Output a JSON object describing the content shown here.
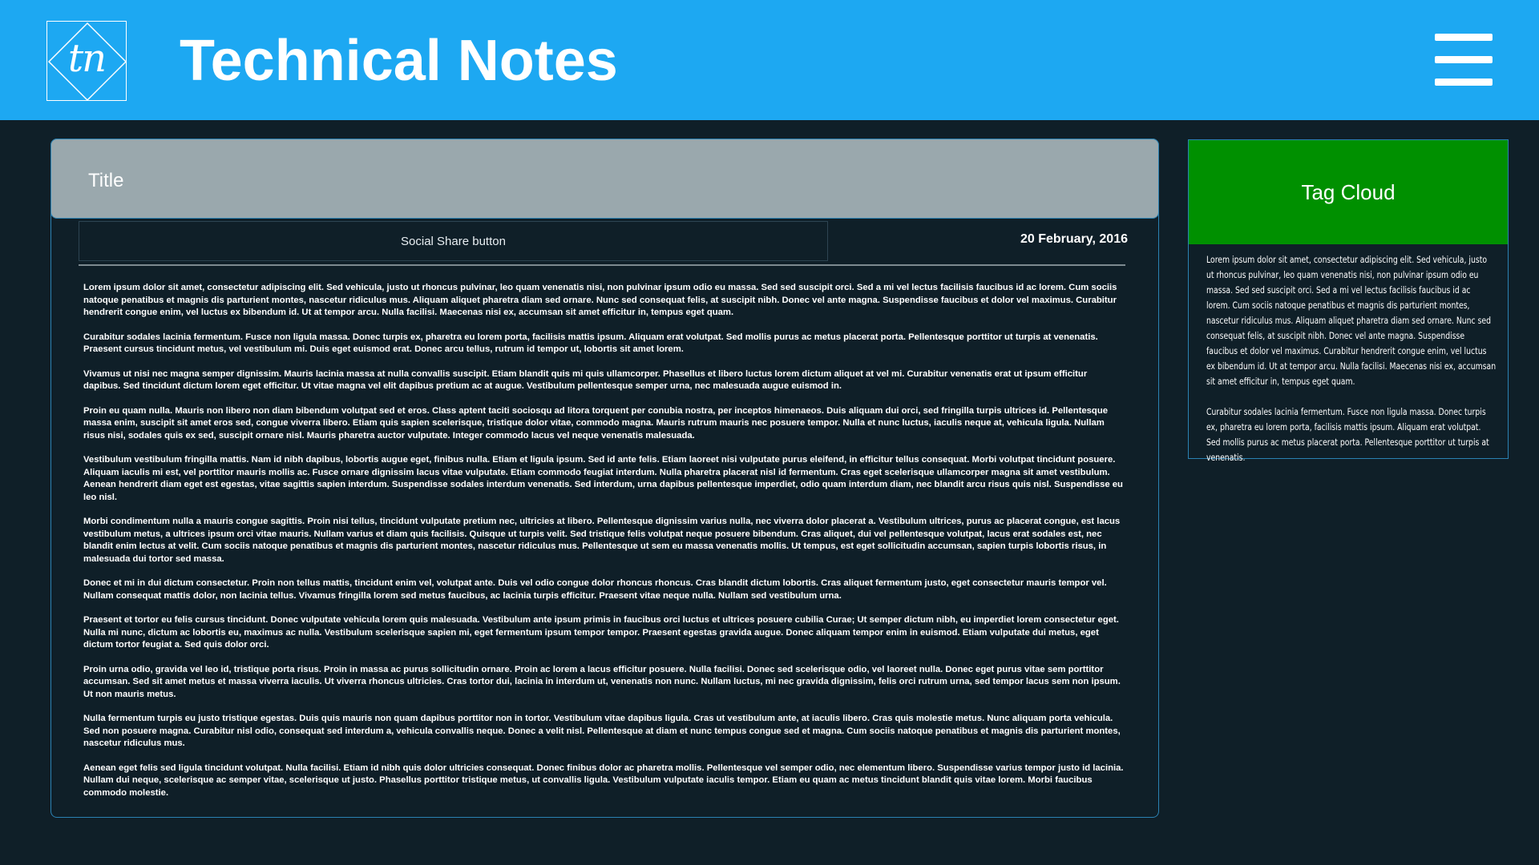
{
  "header": {
    "logo_text": "tn",
    "site_title": "Technical Notes"
  },
  "article": {
    "title": "Title",
    "share_label": "Social Share button",
    "date": "20 February, 2016",
    "paragraphs": [
      "Lorem ipsum dolor sit amet, consectetur adipiscing elit. Sed vehicula, justo ut rhoncus pulvinar, leo quam venenatis nisi, non pulvinar ipsum odio eu massa. Sed sed suscipit orci. Sed a mi vel lectus facilisis faucibus id ac lorem. Cum sociis natoque penatibus et magnis dis parturient montes, nascetur ridiculus mus. Aliquam aliquet pharetra diam sed ornare. Nunc sed consequat felis, at suscipit nibh. Donec vel ante magna. Suspendisse faucibus et dolor vel maximus. Curabitur hendrerit congue enim, vel luctus ex bibendum id. Ut at tempor arcu. Nulla facilisi. Maecenas nisi ex, accumsan sit amet efficitur in, tempus eget quam.",
      "Curabitur sodales lacinia fermentum. Fusce non ligula massa. Donec turpis ex, pharetra eu lorem porta, facilisis mattis ipsum. Aliquam erat volutpat. Sed mollis purus ac metus placerat porta. Pellentesque porttitor ut turpis at venenatis. Praesent cursus tincidunt metus, vel vestibulum mi. Duis eget euismod erat. Donec arcu tellus, rutrum id tempor ut, lobortis sit amet lorem.",
      "Vivamus ut nisi nec magna semper dignissim. Mauris lacinia massa at nulla convallis suscipit. Etiam blandit quis mi quis ullamcorper. Phasellus et libero luctus lorem dictum aliquet at vel mi. Curabitur venenatis erat ut ipsum efficitur dapibus. Sed tincidunt dictum lorem eget efficitur. Ut vitae magna vel elit dapibus pretium ac at augue. Vestibulum pellentesque semper urna, nec malesuada augue euismod in.",
      "Proin eu quam nulla. Mauris non libero non diam bibendum volutpat sed et eros. Class aptent taciti sociosqu ad litora torquent per conubia nostra, per inceptos himenaeos. Duis aliquam dui orci, sed fringilla turpis ultrices id. Pellentesque massa enim, suscipit sit amet eros sed, congue viverra libero. Etiam quis sapien scelerisque, tristique dolor vitae, commodo magna. Mauris rutrum mauris nec posuere tempor. Nulla et nunc luctus, iaculis neque at, vehicula ligula. Nullam risus nisi, sodales quis ex sed, suscipit ornare nisl. Mauris pharetra auctor vulputate. Integer commodo lacus vel neque venenatis malesuada.",
      "Vestibulum vestibulum fringilla mattis. Nam id nibh dapibus, lobortis augue eget, finibus nulla. Etiam et ligula ipsum. Sed id ante felis. Etiam laoreet nisi vulputate purus eleifend, in efficitur tellus consequat. Morbi volutpat tincidunt posuere. Aliquam iaculis mi est, vel porttitor mauris mollis ac. Fusce ornare dignissim lacus vitae vulputate. Etiam commodo feugiat interdum. Nulla pharetra placerat nisl id fermentum. Cras eget scelerisque ullamcorper magna sit amet vestibulum. Aenean hendrerit diam eget est egestas, vitae sagittis sapien interdum. Suspendisse sodales interdum venenatis. Sed interdum, urna dapibus pellentesque imperdiet, odio quam interdum diam, nec blandit arcu risus quis nisl. Suspendisse eu leo nisl.",
      "Morbi condimentum nulla a mauris congue sagittis. Proin nisi tellus, tincidunt vulputate pretium nec, ultricies at libero. Pellentesque dignissim varius nulla, nec viverra dolor placerat a. Vestibulum ultrices, purus ac placerat congue, est lacus vestibulum metus, a ultrices ipsum orci vitae mauris. Nullam varius et diam quis facilisis. Quisque ut turpis velit. Sed tristique felis volutpat neque posuere bibendum. Cras aliquet, dui vel pellentesque volutpat, lacus erat sodales est, nec blandit enim lectus at velit. Cum sociis natoque penatibus et magnis dis parturient montes, nascetur ridiculus mus. Pellentesque ut sem eu massa venenatis mollis. Ut tempus, est eget sollicitudin accumsan, sapien turpis lobortis risus, in malesuada dui tortor sed massa.",
      "Donec et mi in dui dictum consectetur. Proin non tellus mattis, tincidunt enim vel, volutpat ante. Duis vel odio congue dolor rhoncus rhoncus. Cras blandit dictum lobortis. Cras aliquet fermentum justo, eget consectetur mauris tempor vel. Nullam consequat mattis dolor, non lacinia tellus. Vivamus fringilla lorem sed metus faucibus, ac lacinia turpis efficitur. Praesent vitae neque nulla. Nullam sed vestibulum urna.",
      "Praesent et tortor eu felis cursus tincidunt. Donec vulputate vehicula lorem quis malesuada. Vestibulum ante ipsum primis in faucibus orci luctus et ultrices posuere cubilia Curae; Ut semper dictum nibh, eu imperdiet lorem consectetur eget. Nulla mi nunc, dictum ac lobortis eu, maximus ac nulla. Vestibulum scelerisque sapien mi, eget fermentum ipsum tempor tempor. Praesent egestas gravida augue. Donec aliquam tempor enim in euismod. Etiam vulputate dui metus, eget dictum tortor feugiat a. Sed quis dolor orci.",
      "Proin urna odio, gravida vel leo id, tristique porta risus. Proin in massa ac purus sollicitudin ornare. Proin ac lorem a lacus efficitur posuere. Nulla facilisi. Donec sed scelerisque odio, vel laoreet nulla. Donec eget purus vitae sem porttitor accumsan. Sed sit amet metus et massa viverra iaculis. Ut viverra rhoncus ultricies. Cras tortor dui, lacinia in interdum ut, venenatis non nunc. Nullam luctus, mi nec gravida dignissim, felis orci rutrum urna, sed tempor lacus sem non ipsum. Ut non mauris metus.",
      "Nulla fermentum turpis eu justo tristique egestas. Duis quis mauris non quam dapibus porttitor non in tortor. Vestibulum vitae dapibus ligula. Cras ut vestibulum ante, at iaculis libero. Cras quis molestie metus. Nunc aliquam porta vehicula. Sed non posuere magna. Curabitur nisl odio, consequat sed interdum a, vehicula convallis neque. Donec a velit nisl. Pellentesque at diam et nunc tempus congue sed et magna. Cum sociis natoque penatibus et magnis dis parturient montes, nascetur ridiculus mus.",
      "Aenean eget felis sed ligula tincidunt volutpat. Nulla facilisi. Etiam id nibh quis dolor ultricies consequat. Donec finibus dolor ac pharetra mollis. Pellentesque vel semper odio, nec elementum libero. Suspendisse varius tempor justo id lacinia. Nullam dui neque, scelerisque ac semper vitae, scelerisque ut justo. Phasellus porttitor tristique metus, ut convallis ligula. Vestibulum vulputate iaculis tempor. Etiam eu quam ac metus tincidunt blandit quis vitae lorem. Morbi faucibus commodo molestie."
    ]
  },
  "tag_cloud": {
    "title": "Tag Cloud",
    "paragraphs": [
      "Lorem ipsum dolor sit amet, consectetur adipiscing elit. Sed vehicula, justo ut rhoncus pulvinar, leo quam venenatis nisi, non pulvinar ipsum odio eu massa. Sed sed suscipit orci. Sed a mi vel lectus facilisis faucibus id ac lorem. Cum sociis natoque penatibus et magnis dis parturient montes, nascetur ridiculus mus. Aliquam aliquet pharetra diam sed ornare. Nunc sed consequat felis, at suscipit nibh. Donec vel ante magna. Suspendisse faucibus et dolor vel maximus. Curabitur hendrerit congue enim, vel luctus ex bibendum id. Ut at tempor arcu. Nulla facilisi. Maecenas nisi ex, accumsan sit amet efficitur in, tempus eget quam.",
      "Curabitur sodales lacinia fermentum. Fusce non ligula massa. Donec turpis ex, pharetra eu lorem porta, facilisis mattis ipsum. Aliquam erat volutpat. Sed mollis purus ac metus placerat porta. Pellentesque porttitor ut turpis at venenatis."
    ]
  },
  "colors": {
    "header_bg": "#1da8f2",
    "page_bg": "#0f1f28",
    "title_bar_bg": "#9aa8ad",
    "tag_cloud_header_bg": "#009000",
    "border": "#2b82b3"
  },
  "icons": {
    "menu": "hamburger-menu-icon",
    "logo": "diamond-logo"
  }
}
